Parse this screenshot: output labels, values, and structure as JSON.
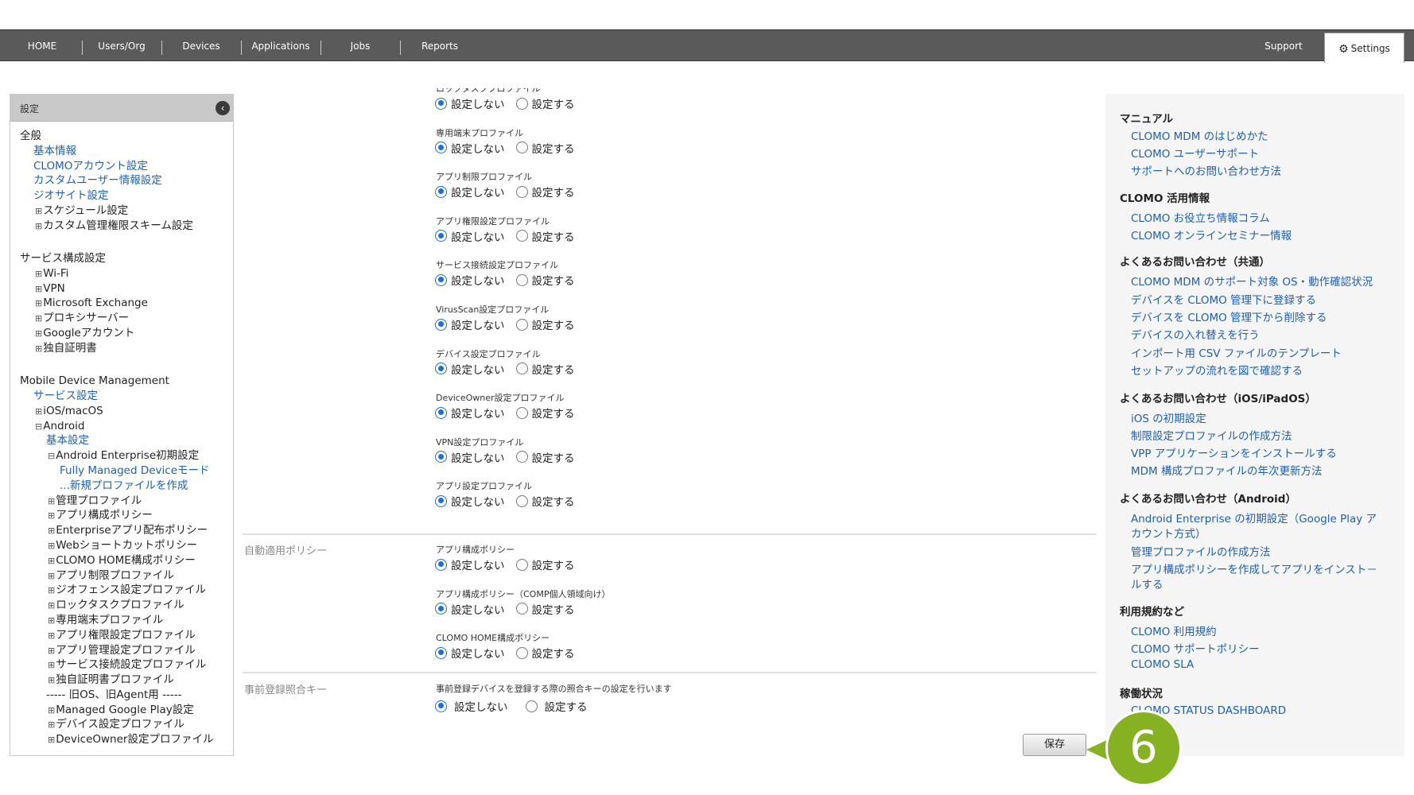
{
  "topnav": {
    "items": [
      "HOME",
      "Users/Org",
      "Devices",
      "Applications",
      "Jobs",
      "Reports"
    ],
    "support": "Support",
    "settings": "Settings"
  },
  "left_panel": {
    "title": "設定",
    "general": {
      "heading": "全般",
      "links": [
        "基本情報",
        "CLOMOアカウント設定",
        "カスタムユーザー情報設定",
        "ジオサイト設定"
      ],
      "expandables": [
        "スケジュール設定",
        "カスタム管理権限スキーム設定"
      ]
    },
    "service_config": {
      "heading": "サービス構成設定",
      "expandables": [
        "Wi-Fi",
        "VPN",
        "Microsoft Exchange",
        "プロキシサーバー",
        "Googleアカウント",
        "独自証明書"
      ]
    },
    "mdm": {
      "heading": "Mobile Device Management",
      "service_settings": "サービス設定",
      "ios": "iOS/macOS",
      "android": "Android",
      "basic": "基本設定",
      "ae_init": "Android Enterprise初期設定",
      "fully_managed": "Fully Managed Deviceモード",
      "new_profile": "...新規プロファイルを作成",
      "items": [
        "管理プロファイル",
        "アプリ構成ポリシー",
        "Enterpriseアプリ配布ポリシー",
        "Webショートカットポリシー",
        "CLOMO HOME構成ポリシー",
        "アプリ制限プロファイル",
        "ジオフェンス設定プロファイル",
        "ロックタスクプロファイル",
        "専用端末プロファイル",
        "アプリ権限設定プロファイル",
        "アプリ管理設定プロファイル",
        "サービス接続設定プロファイル",
        "独自証明書プロファイル"
      ],
      "legacy_divider": "----- 旧OS、旧Agent用 -----",
      "legacy_items": [
        "Managed Google Play設定",
        "デバイス設定プロファイル",
        "DeviceOwner設定プロファイル"
      ]
    }
  },
  "form": {
    "option_no": "設定しない",
    "option_yes": "設定する",
    "profile_fields": [
      "ロックタスクプロファイル",
      "専用端末プロファイル",
      "アプリ制限プロファイル",
      "アプリ権限設定プロファイル",
      "サービス接続設定プロファイル",
      "VirusScan設定プロファイル",
      "デバイス設定プロファイル",
      "DeviceOwner設定プロファイル",
      "VPN設定プロファイル",
      "アプリ設定プロファイル"
    ],
    "auto_policy": {
      "label": "自動適用ポリシー",
      "fields": [
        "アプリ構成ポリシー",
        "アプリ構成ポリシー（COMP個人領域向け）",
        "CLOMO HOME構成ポリシー"
      ]
    },
    "pre_registration": {
      "label": "事前登録照合キー",
      "description": "事前登録デバイスを登録する際の照合キーの設定を行います"
    },
    "save_button": "保存"
  },
  "right_panel": {
    "manual": {
      "heading": "マニュアル",
      "links": [
        "CLOMO MDM のはじめかた",
        "CLOMO ユーザーサポート",
        "サポートへのお問い合わせ方法"
      ]
    },
    "tips": {
      "heading": "CLOMO 活用情報",
      "links": [
        "CLOMO お役立ち情報コラム",
        "CLOMO オンラインセミナー情報"
      ]
    },
    "faq_common": {
      "heading": "よくあるお問い合わせ（共通）",
      "links": [
        "CLOMO MDM のサポート対象 OS・動作確認状況",
        "デバイスを CLOMO 管理下に登録する",
        "デバイスを CLOMO 管理下から削除する",
        "デバイスの入れ替えを行う",
        "インポート用 CSV ファイルのテンプレート",
        "セットアップの流れを図で確認する"
      ]
    },
    "faq_ios": {
      "heading": "よくあるお問い合わせ（iOS/iPadOS）",
      "links": [
        "iOS の初期設定",
        "制限設定プロファイルの作成方法",
        "VPP アプリケーションをインストールする",
        "MDM 構成プロファイルの年次更新方法"
      ]
    },
    "faq_android": {
      "heading": "よくあるお問い合わせ（Android）",
      "links": [
        "Android Enterprise の初期設定（Google Play ア",
        "カウント方式）",
        "管理プロファイルの作成方法",
        "アプリ構成ポリシーを作成してアプリをインスト－",
        "ルする"
      ]
    },
    "terms": {
      "heading": "利用規約など",
      "links": [
        "CLOMO 利用規約",
        "CLOMO サポートポリシー",
        "CLOMO SLA"
      ]
    },
    "status": {
      "heading": "稼働状況",
      "link": "CLOMO STATUS DASHBOARD"
    }
  },
  "callout_number": "6",
  "colors": {
    "nav_bg": "#5a5a5a",
    "link": "#1f5fae",
    "radio_checked": "#1b6fd6",
    "callout": "#86b123"
  }
}
